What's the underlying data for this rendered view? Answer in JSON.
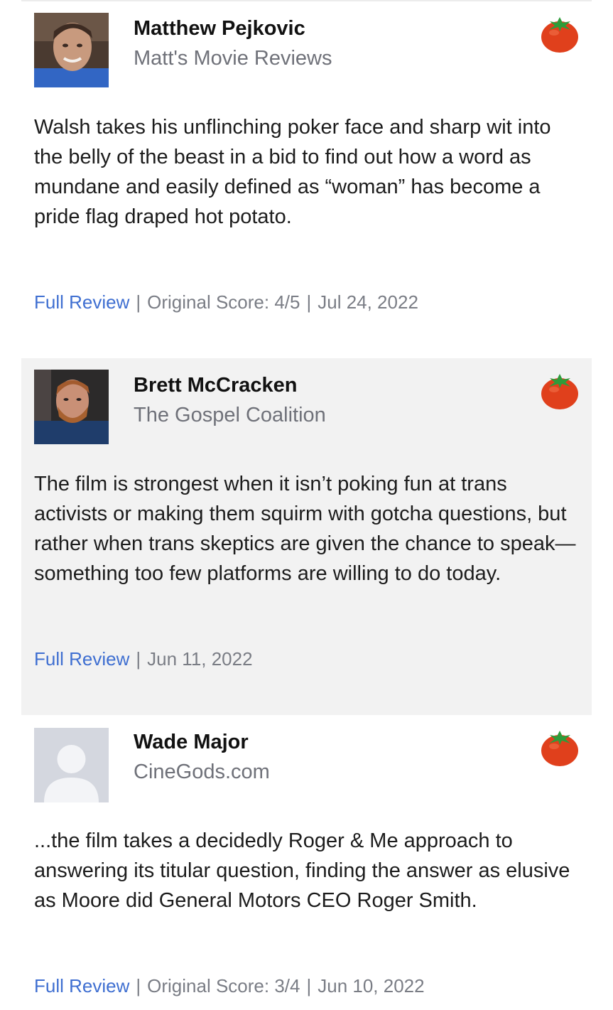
{
  "reviews": [
    {
      "critic_name": "Matthew Pejkovic",
      "publication": "Matt's Movie Reviews",
      "rating_icon": "fresh-tomato-icon",
      "quote": "Walsh takes his unflinching poker face and sharp wit into the belly of the beast in a bid to find out how a word as mundane and easily defined as “woman” has become a pride flag draped hot potato.",
      "full_review_label": "Full Review",
      "original_score": "Original Score: 4/5",
      "date": "Jul 24, 2022"
    },
    {
      "critic_name": "Brett McCracken",
      "publication": "The Gospel Coalition",
      "rating_icon": "fresh-tomato-icon",
      "quote": "The film is strongest when it isn’t poking fun at trans activists or making them squirm with gotcha questions, but rather when trans skeptics are given the chance to speak—something too few platforms are willing to do today.",
      "full_review_label": "Full Review",
      "date": "Jun 11, 2022"
    },
    {
      "critic_name": "Wade Major",
      "publication": "CineGods.com",
      "rating_icon": "fresh-tomato-icon",
      "quote": "...the film takes a decidedly Roger & Me approach to answering its titular question, finding the answer as elusive as Moore did General Motors CEO Roger Smith.",
      "full_review_label": "Full Review",
      "original_score": "Original Score: 3/4",
      "date": "Jun 10, 2022"
    }
  ],
  "colors": {
    "link": "#3f6fd1",
    "meta_text": "#7a7d85",
    "shaded_card": "#f2f2f2",
    "tomato_red": "#e0401c",
    "tomato_leaf": "#2e9c3a"
  }
}
